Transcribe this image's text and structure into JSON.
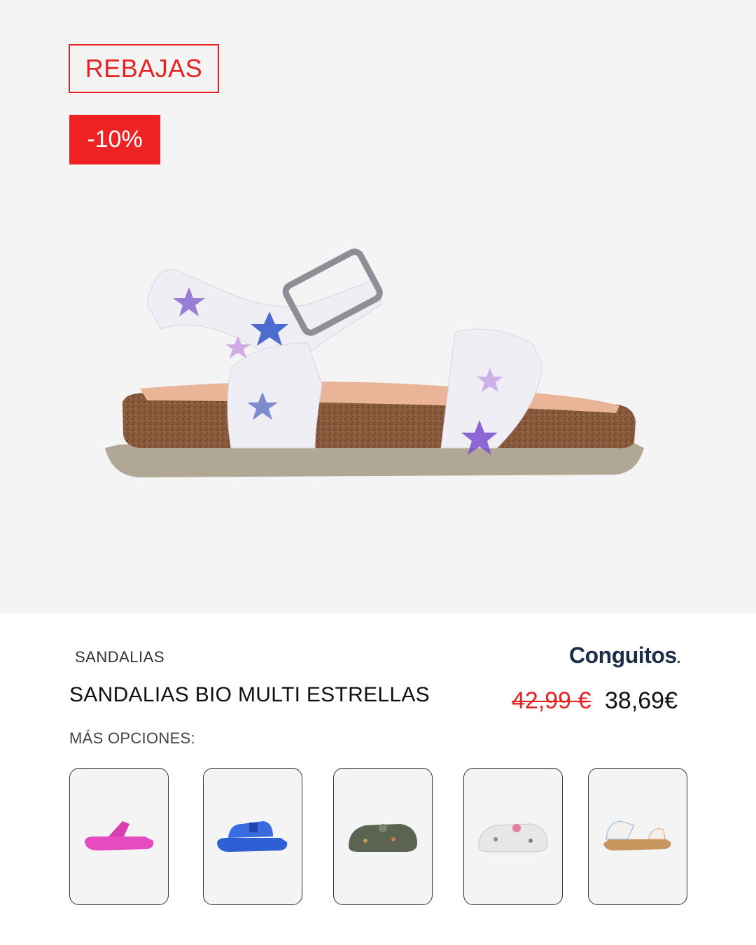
{
  "badges": {
    "sale": "REBAJAS",
    "discount": "-10%"
  },
  "product": {
    "category": "SANDALIAS",
    "name": "SANDALIAS BIO MULTI ESTRELLAS",
    "price_old": "42,99 €",
    "price_new": "38,69€",
    "brand": "Conguitos",
    "brand_mark": "."
  },
  "options": {
    "label": "MÁS OPCIONES:",
    "items": [
      {
        "icon": "pink-flip-flop-icon",
        "color": "#e64bbf"
      },
      {
        "icon": "blue-sandal-icon",
        "color": "#2f5fd4"
      },
      {
        "icon": "khaki-clog-icon",
        "color": "#5b6352"
      },
      {
        "icon": "white-print-clog-icon",
        "color": "#e9e6e6"
      },
      {
        "icon": "print-bio-sandal-icon",
        "color": "#f3f1ee"
      }
    ]
  },
  "colors": {
    "accent_red": "#e62222",
    "brand_navy": "#1c2e4a"
  }
}
